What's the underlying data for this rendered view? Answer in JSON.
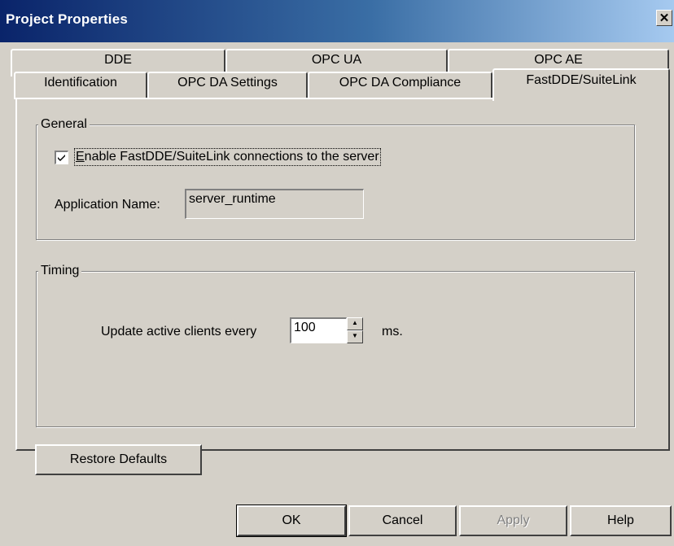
{
  "window": {
    "title": "Project Properties",
    "close_glyph": "✕"
  },
  "tabs": {
    "row_back": [
      {
        "label": "DDE"
      },
      {
        "label": "OPC UA"
      },
      {
        "label": "OPC AE"
      }
    ],
    "row_front": [
      {
        "label": "Identification"
      },
      {
        "label": "OPC DA Settings"
      },
      {
        "label": "OPC DA Compliance"
      },
      {
        "label": "FastDDE/SuiteLink",
        "active": true
      }
    ]
  },
  "general": {
    "legend": "General",
    "enable_checkbox": {
      "checked": true,
      "label": "Enable FastDDE/SuiteLink connections to the server"
    },
    "app_name_label": "Application Name:",
    "app_name_value": "server_runtime"
  },
  "timing": {
    "legend": "Timing",
    "update_label": "Update active clients every",
    "update_value": "100",
    "unit": "ms."
  },
  "buttons": {
    "restore_defaults": "Restore Defaults",
    "ok": "OK",
    "cancel": "Cancel",
    "apply": "Apply",
    "help": "Help"
  },
  "icons": {
    "check": "check-icon",
    "spin_up": "spin-up-icon",
    "spin_down": "spin-down-icon",
    "close": "close-icon"
  }
}
